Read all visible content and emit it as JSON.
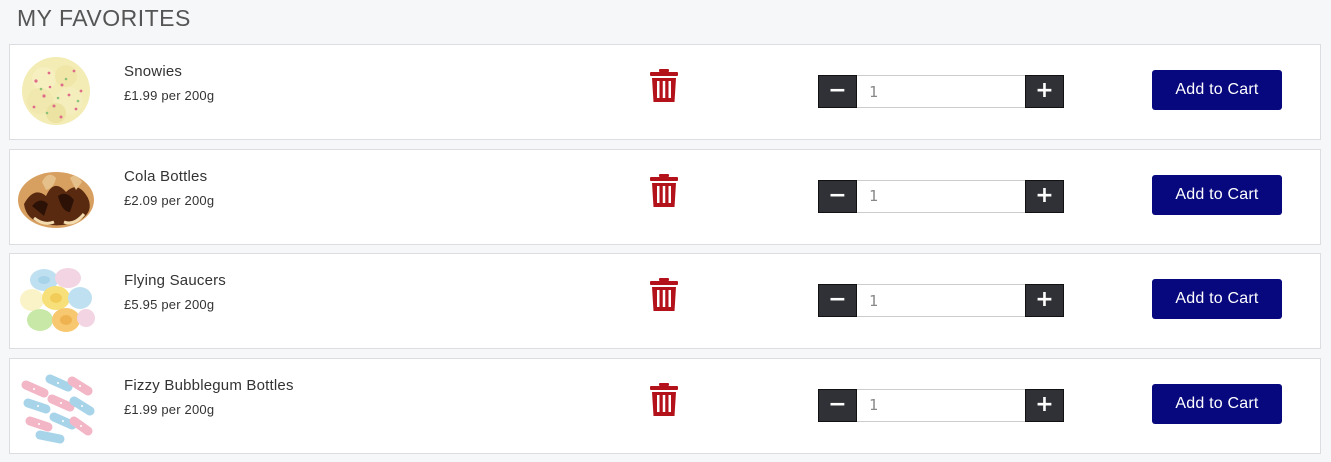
{
  "page": {
    "title": "MY FAVORITES"
  },
  "favorites": [
    {
      "name": "Snowies",
      "price": "£1.99 per 200g",
      "quantity": "1",
      "image": "snowies-candy"
    },
    {
      "name": "Cola Bottles",
      "price": "£2.09 per 200g",
      "quantity": "1",
      "image": "cola-bottles-candy"
    },
    {
      "name": "Flying Saucers",
      "price": "£5.95 per 200g",
      "quantity": "1",
      "image": "flying-saucers-candy"
    },
    {
      "name": "Fizzy Bubblegum Bottles",
      "price": "£1.99 per 200g",
      "quantity": "1",
      "image": "fizzy-bubblegum-bottles-candy"
    }
  ],
  "controls": {
    "add_to_cart_label": "Add to Cart",
    "decrement_symbol": "−",
    "increment_symbol": "+",
    "remove_icon": "trash-icon"
  },
  "colors": {
    "accent": "#08087e",
    "trash": "#b3121b",
    "stepper": "#2f3136"
  }
}
